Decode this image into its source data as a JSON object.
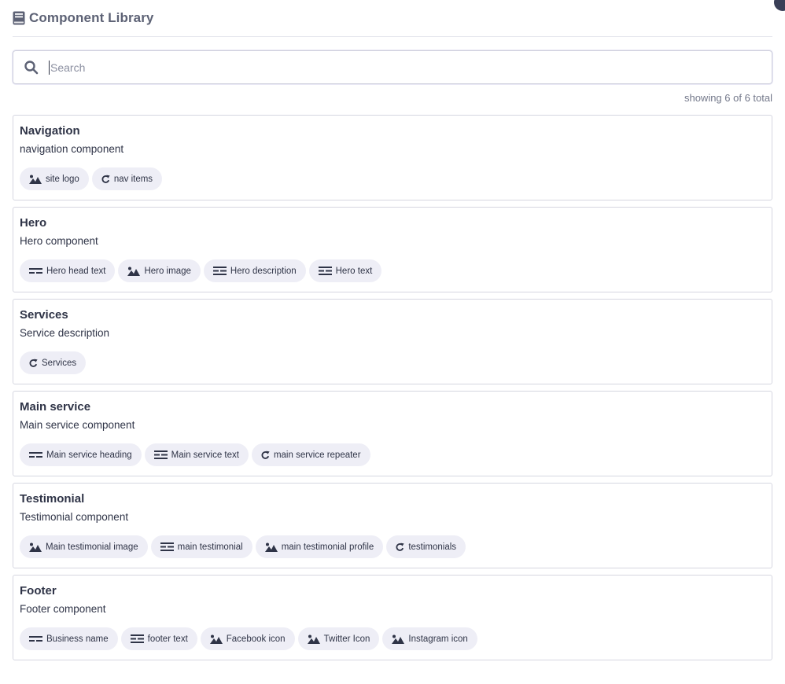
{
  "header": {
    "title": "Component Library",
    "icon": "book-icon"
  },
  "search": {
    "placeholder": "Search",
    "value": "",
    "icon": "search-icon"
  },
  "summary": "showing 6 of 6 total",
  "colors": {
    "text": "#2f3447",
    "chip_bg": "#eeeef6",
    "border": "#d5d6e0",
    "muted": "#73788a"
  },
  "components": [
    {
      "title": "Navigation",
      "description": "navigation component",
      "fields": [
        {
          "label": "site logo",
          "icon": "image-icon"
        },
        {
          "label": "nav items",
          "icon": "repeat-icon"
        }
      ]
    },
    {
      "title": "Hero",
      "description": "Hero component",
      "fields": [
        {
          "label": "Hero head text",
          "icon": "text-line-icon"
        },
        {
          "label": "Hero image",
          "icon": "image-icon"
        },
        {
          "label": "Hero description",
          "icon": "paragraph-icon"
        },
        {
          "label": "Hero text",
          "icon": "paragraph-icon"
        }
      ]
    },
    {
      "title": "Services",
      "description": "Service description",
      "fields": [
        {
          "label": "Services",
          "icon": "repeat-icon"
        }
      ]
    },
    {
      "title": "Main service",
      "description": "Main service component",
      "fields": [
        {
          "label": "Main service heading",
          "icon": "text-line-icon"
        },
        {
          "label": "Main service text",
          "icon": "paragraph-icon"
        },
        {
          "label": "main service repeater",
          "icon": "repeat-icon"
        }
      ]
    },
    {
      "title": "Testimonial",
      "description": "Testimonial component",
      "fields": [
        {
          "label": "Main testimonial image",
          "icon": "image-icon"
        },
        {
          "label": "main testimonial",
          "icon": "paragraph-icon"
        },
        {
          "label": "main testimonial profile",
          "icon": "image-icon"
        },
        {
          "label": "testimonials",
          "icon": "repeat-icon"
        }
      ]
    },
    {
      "title": "Footer",
      "description": "Footer component",
      "fields": [
        {
          "label": "Business name",
          "icon": "text-line-icon"
        },
        {
          "label": "footer text",
          "icon": "paragraph-icon"
        },
        {
          "label": "Facebook icon",
          "icon": "image-icon"
        },
        {
          "label": "Twitter Icon",
          "icon": "image-icon"
        },
        {
          "label": "Instagram icon",
          "icon": "image-icon"
        }
      ]
    }
  ]
}
